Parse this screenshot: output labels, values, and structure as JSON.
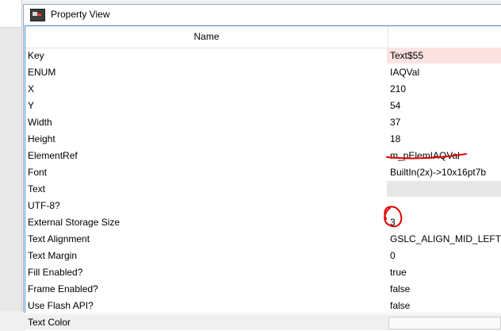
{
  "window": {
    "title": "Property View"
  },
  "grid": {
    "header": {
      "name": "Name",
      "value": ""
    },
    "rows": [
      {
        "key": "Key",
        "value": "Text$55",
        "state": "selected"
      },
      {
        "key": "ENUM",
        "value": "IAQVal"
      },
      {
        "key": "X",
        "value": "210"
      },
      {
        "key": "Y",
        "value": "54"
      },
      {
        "key": "Width",
        "value": "37"
      },
      {
        "key": "Height",
        "value": "18"
      },
      {
        "key": "ElementRef",
        "value": "m_pElemIAQVal"
      },
      {
        "key": "Font",
        "value": "BuiltIn(2x)->10x16pt7b"
      },
      {
        "key": "Text",
        "value": "",
        "state": "empty"
      },
      {
        "key": "UTF-8?",
        "value": ""
      },
      {
        "key": "External Storage Size",
        "value": "3"
      },
      {
        "key": "Text Alignment",
        "value": "GSLC_ALIGN_MID_LEFT"
      },
      {
        "key": "Text Margin",
        "value": "0"
      },
      {
        "key": "Fill Enabled?",
        "value": "true"
      },
      {
        "key": "Frame Enabled?",
        "value": "false"
      },
      {
        "key": "Use Flash API?",
        "value": "false"
      },
      {
        "key": "Text Color",
        "value": "",
        "state": "swatch"
      }
    ]
  },
  "annotation_color": "#e00000"
}
